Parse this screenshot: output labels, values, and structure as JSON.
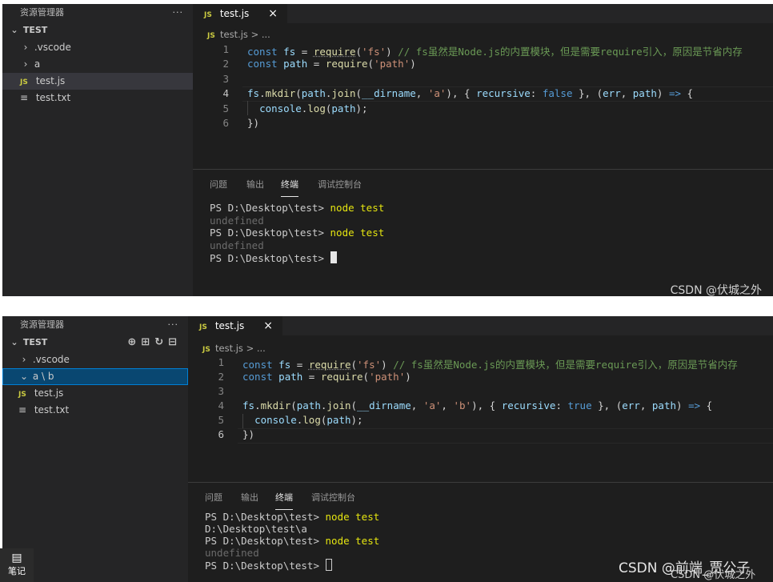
{
  "shot1": {
    "explorer_title": "资源管理器",
    "more": "···",
    "folder": "TEST",
    "tree": [
      {
        "label": ".vscode",
        "kind": "folder"
      },
      {
        "label": "a",
        "kind": "folder"
      },
      {
        "label": "test.js",
        "kind": "js"
      },
      {
        "label": "test.txt",
        "kind": "txt"
      }
    ],
    "tab_label": "test.js",
    "tab_icon": "JS",
    "close": "×",
    "breadcrumb": "test.js > ...",
    "line_numbers": [
      "1",
      "2",
      "3",
      "4",
      "5",
      "6"
    ],
    "panel_tabs": [
      "问题",
      "输出",
      "终端",
      "调试控制台"
    ],
    "terminal": [
      {
        "prompt": "PS D:\\Desktop\\test> ",
        "cmd": "node test"
      },
      {
        "dim": "undefined"
      },
      {
        "prompt": "PS D:\\Desktop\\test> ",
        "cmd": "node test"
      },
      {
        "dim": "undefined"
      },
      {
        "prompt": "PS D:\\Desktop\\test> ",
        "cmd": ""
      }
    ],
    "watermark": "CSDN @伏城之外"
  },
  "shot2": {
    "explorer_title": "资源管理器",
    "more": "···",
    "folder": "TEST",
    "toolbar_icons": [
      "new-file-icon",
      "new-folder-icon",
      "refresh-icon",
      "collapse-icon"
    ],
    "tree": [
      {
        "label": ".vscode",
        "kind": "folder"
      },
      {
        "label": "a \\ b",
        "kind": "folder-open"
      },
      {
        "label": "test.js",
        "kind": "js"
      },
      {
        "label": "test.txt",
        "kind": "txt"
      }
    ],
    "tab_label": "test.js",
    "tab_icon": "JS",
    "close": "×",
    "breadcrumb": "test.js > ...",
    "line_numbers": [
      "1",
      "2",
      "3",
      "4",
      "5",
      "6"
    ],
    "panel_tabs": [
      "问题",
      "输出",
      "终端",
      "调试控制台"
    ],
    "terminal": [
      {
        "prompt": "PS D:\\Desktop\\test> ",
        "cmd": "node test"
      },
      {
        "plain": "D:\\Desktop\\test\\a"
      },
      {
        "prompt": "PS D:\\Desktop\\test> ",
        "cmd": "node test"
      },
      {
        "dim": "undefined"
      },
      {
        "prompt": "PS D:\\Desktop\\test> ",
        "cmd": ""
      }
    ],
    "watermark_main": "CSDN @前端_贾公子",
    "watermark_sub": "CSDN @伏城之外",
    "notes_label": "笔记"
  },
  "code1": [
    [
      "const",
      " ",
      "fs",
      " = ",
      "require",
      "(",
      "'fs'",
      ") ",
      "// fs虽然是Node.js的内置模块，但是需要require引入，原因是节省内存"
    ],
    [
      "const",
      " ",
      "path",
      " = ",
      "require",
      "(",
      "'path'",
      ")",
      ""
    ],
    [],
    [
      "fs.mkdir(path.join(__dirname, 'a'), { recursive: false }, (err, path) => {"
    ],
    [
      "  console.log(path);"
    ],
    [
      "})"
    ]
  ],
  "code2_line4": "fs.mkdir(path.join(__dirname, 'a', 'b'), { recursive: true }, (err, path) => {"
}
